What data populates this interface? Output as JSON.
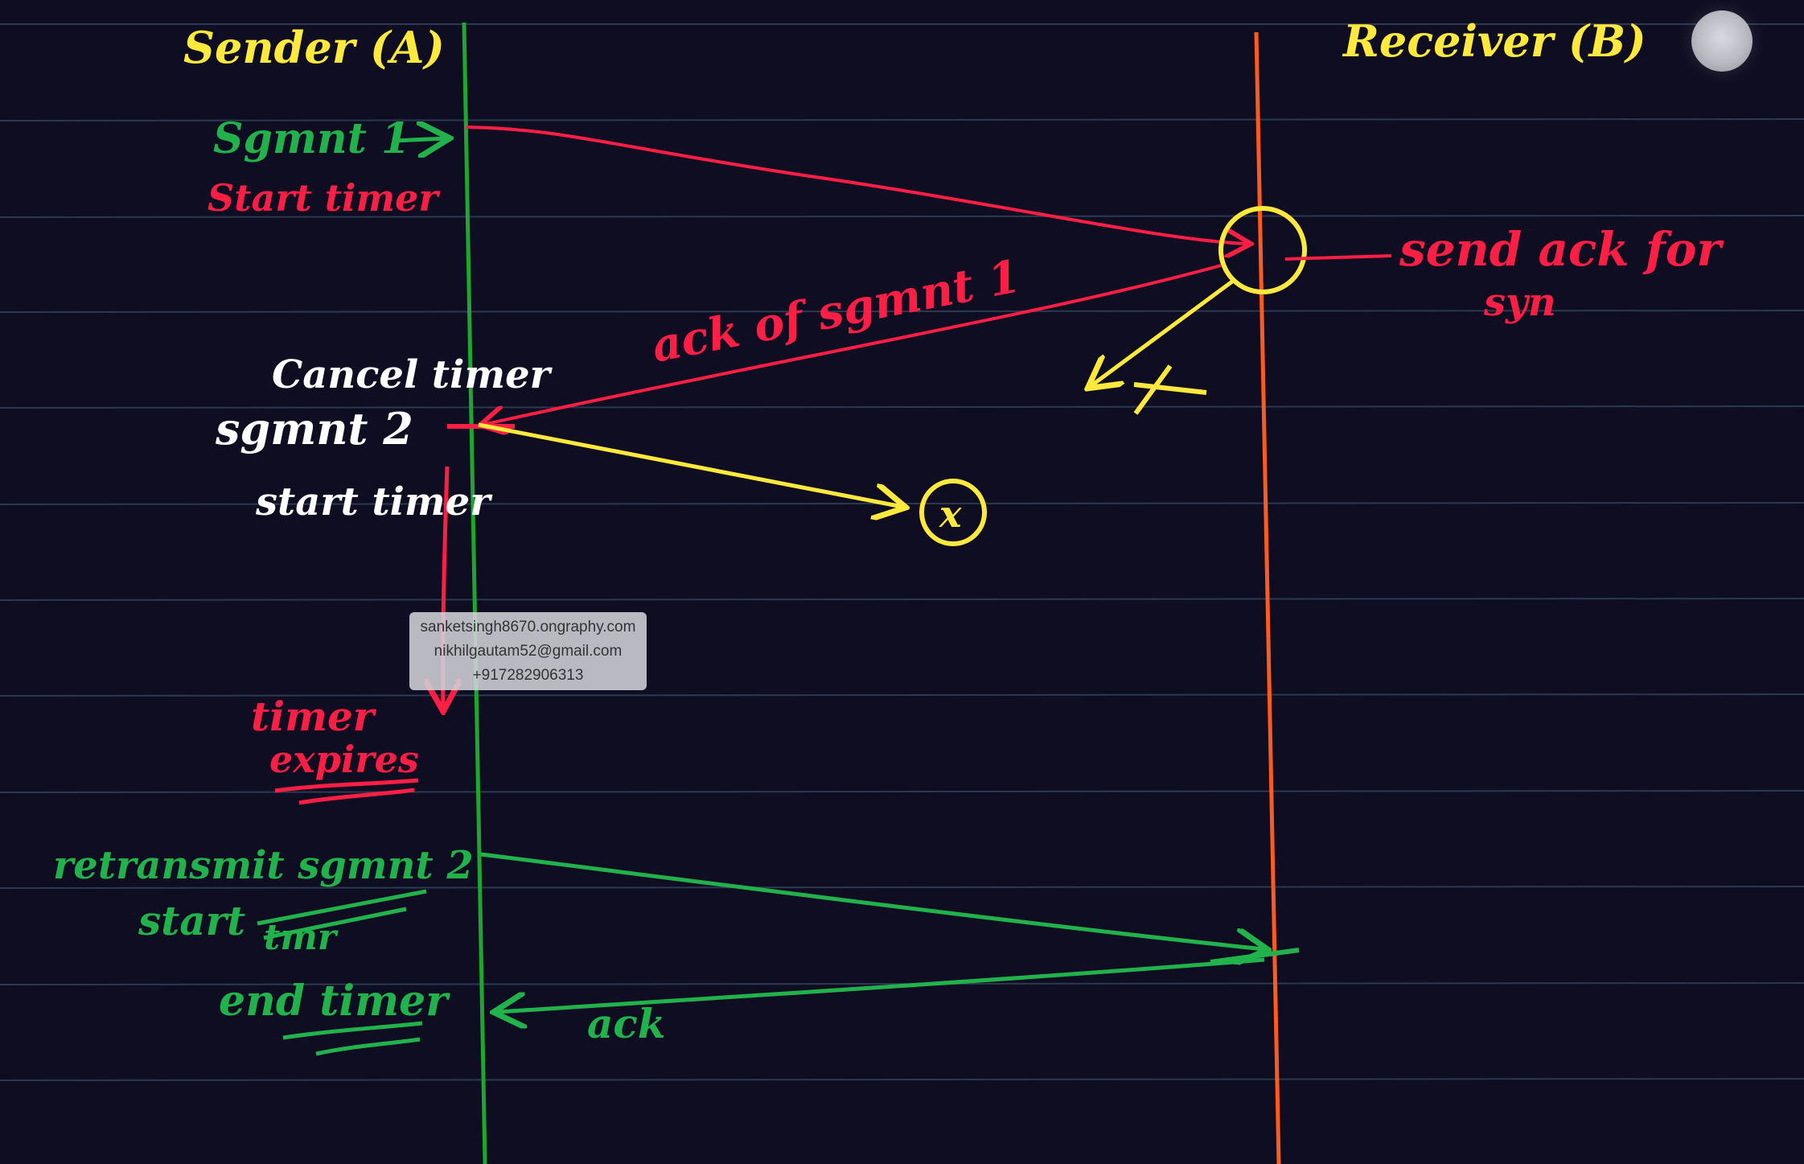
{
  "colors": {
    "background": "#0f0d21",
    "rule_line": "#2b3a4e",
    "sender_line": "#1fa62e",
    "receiver_line": "#ff5a1f",
    "red_ink": "#ff1e44",
    "yellow_ink": "#ffe93d",
    "green_ink": "#22b24b",
    "white_ink": "#ffffff"
  },
  "headings": {
    "sender": "Sender (A)",
    "receiver": "Receiver (B)"
  },
  "annotations": {
    "segment1": "Sgmnt 1",
    "start_timer_1": "Start timer",
    "send_ack_line1": "send ack for",
    "send_ack_line2": "syn",
    "ack_of_segment1": "ack of sgmnt 1",
    "cancel_timer": "Cancel timer",
    "segment2": "sgmnt 2",
    "start_timer_2": "start timer",
    "timer": "timer",
    "expires": "expires",
    "retransmit_segment2": "retransmit sgmnt 2",
    "start": "start",
    "timer_struck": "tmr",
    "end_timer": "end timer",
    "ack": "ack",
    "lost_mark": "X",
    "lost_mark_circled": "x"
  },
  "watermark": {
    "line1": "sanketsingh8670.ongraphy.com",
    "line2": "nikhilgautam52@gmail.com",
    "line3": "+917282906313"
  },
  "icons": {
    "record_button": "record-indicator-icon"
  }
}
